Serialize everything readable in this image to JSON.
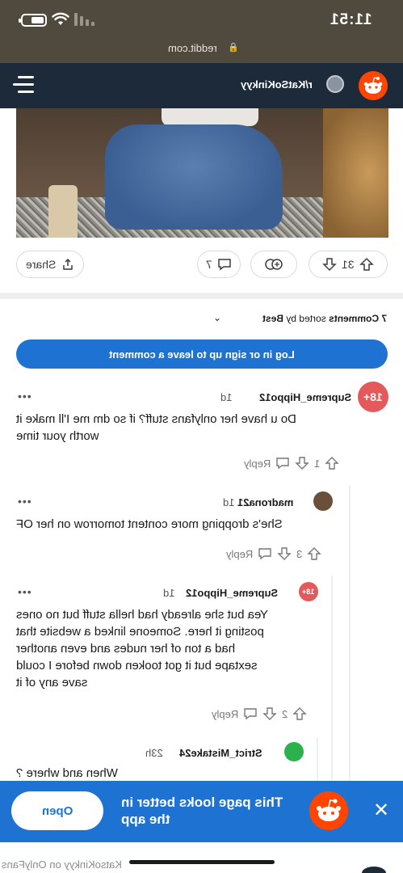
{
  "status_bar": {
    "time": "11:51"
  },
  "browser": {
    "url": "reddit.com"
  },
  "header": {
    "subreddit": "r/KatSoKinkyy"
  },
  "post_actions": {
    "votes": "31",
    "comments": "7",
    "share_label": "Share"
  },
  "comments_section": {
    "count_label": "7 Comments",
    "sorted_by_label": "sorted by",
    "sort_value": "Best",
    "login_label": "Log in or sign up to leave a comment"
  },
  "comments": [
    {
      "author": "Supreme_Hippo12",
      "time": "1d",
      "badge": "18+",
      "body": "Do u have her onlyfans stuff? if so dm me I'll make it\nworth your time",
      "votes": "1",
      "reply_label": "Reply"
    },
    {
      "author": "madrona21",
      "time": "1d",
      "body": "She's dropping more content tomorrow on her OF",
      "votes": "3",
      "reply_label": "Reply"
    },
    {
      "author": "Supreme_Hippo12",
      "time": "1d",
      "badge": "18+",
      "body": "Yea but she already had hella stuff but no ones\nposting it here. Someone linked a website that\nhad a ton of her nudes and even another\nsextape but it got tooken down before I could\nsave any of it",
      "votes": "2",
      "reply_label": "Reply"
    },
    {
      "author": "Strict_Mistake24",
      "time": "23h",
      "body": "When and where ?"
    }
  ],
  "banner": {
    "message": "This page looks better in the app",
    "open_label": "Open"
  },
  "tab_preview": {
    "title": "KatsoKinkyy on OnlyFans"
  },
  "colors": {
    "accent": "#1e73d2",
    "reddit_orange": "#ff4500",
    "header_bg": "#1c2a3a",
    "badge_red": "#e45a5a"
  }
}
